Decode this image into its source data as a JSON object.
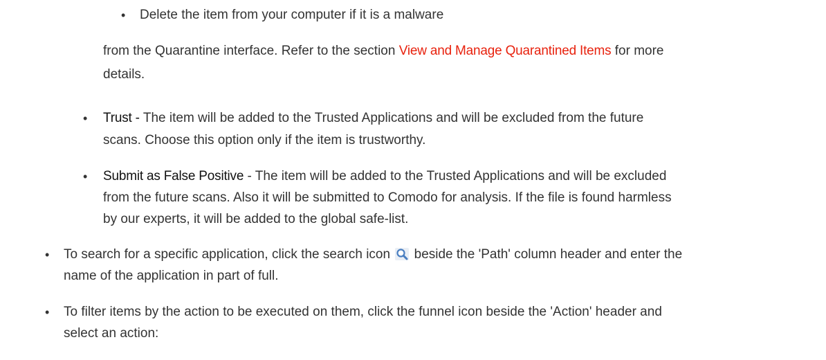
{
  "sub_bullets_top": [
    {
      "text": "Delete the item from your computer if it is a malware"
    }
  ],
  "quarantine_paragraph": {
    "before": "from the Quarantine interface. Refer to the section ",
    "link": "View and Manage Quarantined Items",
    "after": " for more",
    "line2": "details."
  },
  "options": [
    {
      "term": "Trust - ",
      "line1": "The item will be added to the Trusted Applications and will be excluded from the future",
      "line2": "scans. Choose this option only if the item is trustworthy."
    },
    {
      "term": "Submit as False Positive",
      "line1": " - The item will be added to the Trusted Applications and will be excluded",
      "line2": "from the future scans. Also it will be submitted to Comodo for analysis. If the file is found harmless",
      "line3": "by our experts, it will be added to the global safe-list."
    }
  ],
  "steps": [
    {
      "before_icon": "To search for a specific application, click the search icon ",
      "icon": "search-icon",
      "after_icon": " beside the 'Path' column header and enter the",
      "line2": "name of the application in part of full."
    },
    {
      "line1": "To filter items by the action to be executed on them, click the funnel icon beside the 'Action' header and",
      "line2": "select an action:"
    }
  ],
  "bullet_glyph": "•",
  "colors": {
    "link": "#e8220e",
    "text": "#333333",
    "icon": "#4a7fc1"
  }
}
